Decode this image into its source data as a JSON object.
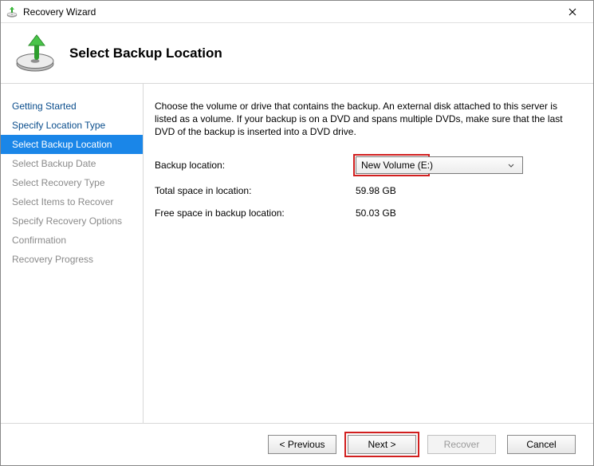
{
  "window": {
    "title": "Recovery Wizard"
  },
  "header": {
    "page_title": "Select Backup Location"
  },
  "sidebar": {
    "items": [
      {
        "label": "Getting Started",
        "state": "done"
      },
      {
        "label": "Specify Location Type",
        "state": "done"
      },
      {
        "label": "Select Backup Location",
        "state": "selected"
      },
      {
        "label": "Select Backup Date",
        "state": "disabled"
      },
      {
        "label": "Select Recovery Type",
        "state": "disabled"
      },
      {
        "label": "Select Items to Recover",
        "state": "disabled"
      },
      {
        "label": "Specify Recovery Options",
        "state": "disabled"
      },
      {
        "label": "Confirmation",
        "state": "disabled"
      },
      {
        "label": "Recovery Progress",
        "state": "disabled"
      }
    ]
  },
  "main": {
    "instructions": "Choose the volume or drive that contains the backup. An external disk attached to this server is listed as a volume. If your backup is on a DVD and spans multiple DVDs, make sure that the last DVD of the backup is inserted into a DVD drive.",
    "backup_location_label": "Backup location:",
    "backup_location_value": "New Volume (E:)",
    "total_space_label": "Total space in location:",
    "total_space_value": "59.98 GB",
    "free_space_label": "Free space in backup location:",
    "free_space_value": "50.03 GB"
  },
  "footer": {
    "previous": "< Previous",
    "next": "Next >",
    "recover": "Recover",
    "cancel": "Cancel"
  }
}
